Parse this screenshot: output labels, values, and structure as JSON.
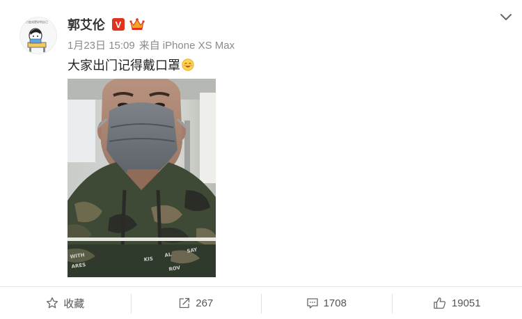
{
  "post": {
    "author_name": "郭艾伦",
    "verified_badge": "V",
    "crown_icon": "crown-icon",
    "timestamp": "1月23日 15:09",
    "source_prefix": "来自",
    "source_device": "iPhone XS Max",
    "text": "大家出门记得戴口罩",
    "emoji": "smiling-face-emoji"
  },
  "actions": {
    "favorite_label": "收藏",
    "repost_count": "267",
    "comment_count": "1708",
    "like_count": "19051"
  },
  "colors": {
    "verified_red": "#e0321e",
    "crown_orange": "#f5a623",
    "meta_gray": "#8a8a8a"
  }
}
